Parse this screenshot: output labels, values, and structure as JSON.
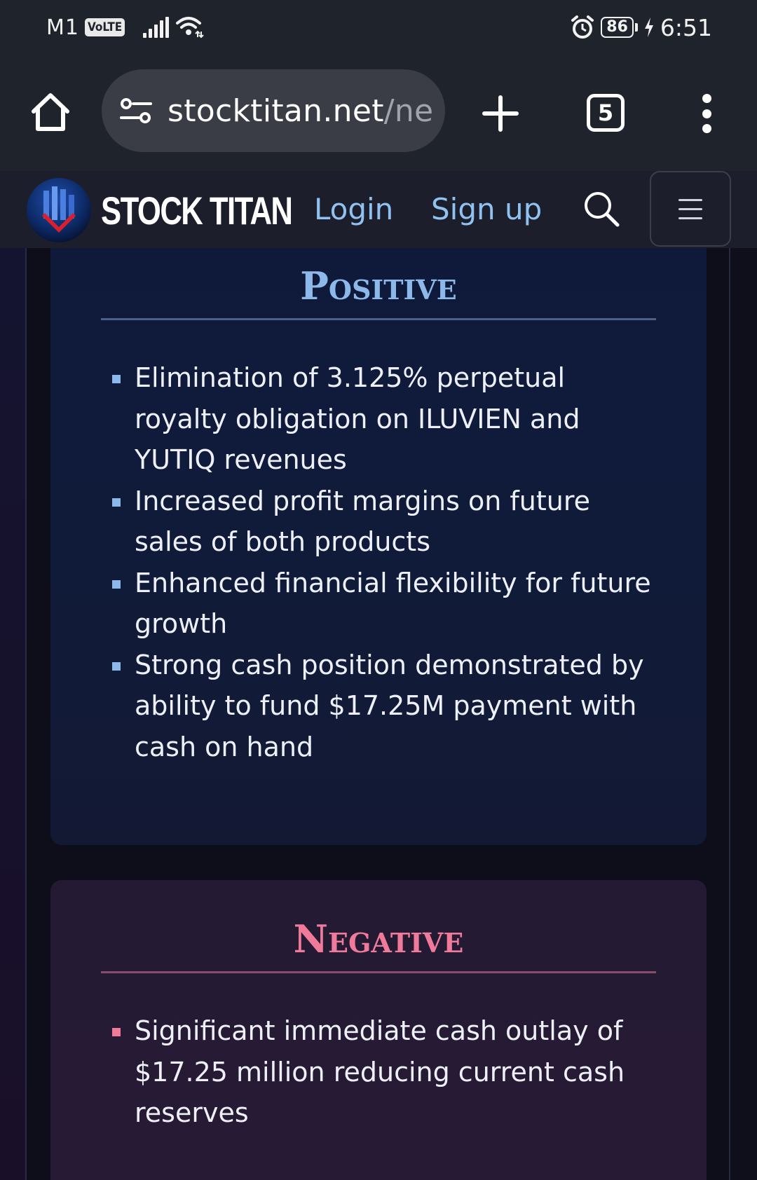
{
  "status_bar": {
    "carrier": "M1",
    "volte": "VoLTE",
    "battery": "86",
    "time": "6:51"
  },
  "browser": {
    "url_main": "stocktitan.net",
    "url_rest": "/ne",
    "tab_count": "5"
  },
  "site_header": {
    "brand": "STOCK TITAN",
    "login": "Login",
    "signup": "Sign up"
  },
  "positive": {
    "title": "Positive",
    "items": [
      "Elimination of 3.125% perpetual royalty obligation on ILUVIEN and YUTIQ revenues",
      "Increased profit margins on future sales of both products",
      "Enhanced financial flexibility for future growth",
      "Strong cash position demonstrated by ability to fund $17.25M payment with cash on hand"
    ]
  },
  "negative": {
    "title": "Negative",
    "items": [
      "Significant immediate cash outlay of $17.25 million reducing current cash reserves"
    ]
  },
  "colors": {
    "positive_accent": "#8cb8ea",
    "negative_accent": "#f07a9a",
    "link": "#8fc2f0"
  },
  "icons": [
    "home-icon",
    "site-settings-icon",
    "plus-icon",
    "tabs-icon",
    "more-vert-icon",
    "search-icon",
    "menu-icon",
    "alarm-icon",
    "wifi-icon",
    "signal-icon",
    "charging-icon"
  ]
}
